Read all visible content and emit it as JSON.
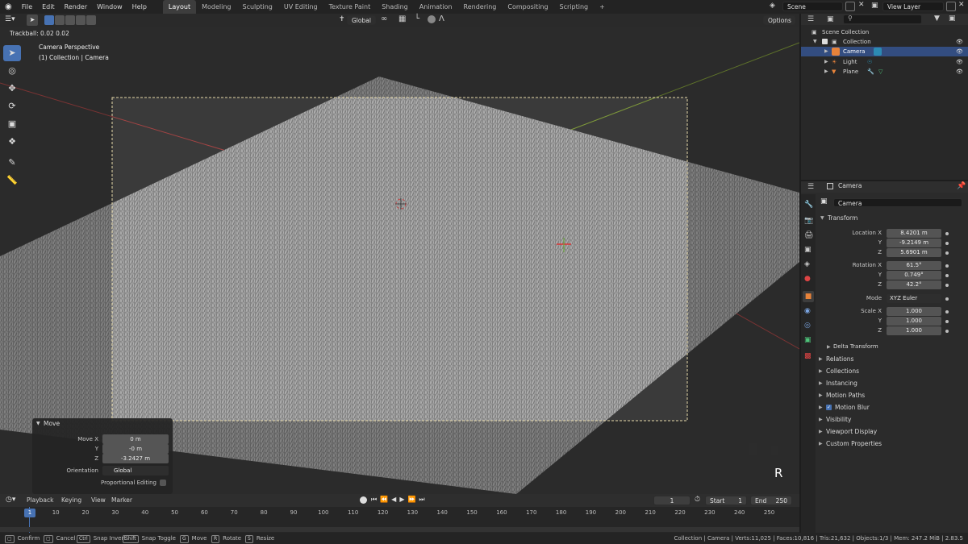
{
  "menu": {
    "items": [
      "File",
      "Edit",
      "Render",
      "Window",
      "Help"
    ],
    "workspaces": [
      "Layout",
      "Modeling",
      "Sculpting",
      "UV Editing",
      "Texture Paint",
      "Shading",
      "Animation",
      "Rendering",
      "Compositing",
      "Scripting"
    ],
    "active_workspace": "Layout",
    "add_tab": "+",
    "scene": "Scene",
    "view_layer": "View Layer"
  },
  "view_header": {
    "orientation": "Global",
    "options": "Options"
  },
  "viewport": {
    "trackball": "Trackball: 0.02 0.02",
    "view_name": "Camera Perspective",
    "view_collection": "(1) Collection | Camera",
    "key_indicator": "R"
  },
  "move_panel": {
    "title": "Move",
    "move_x_label": "Move X",
    "move_x": "0 m",
    "y_label": "Y",
    "y": "-0 m",
    "z_label": "Z",
    "z": "-3.2427 m",
    "orientation_label": "Orientation",
    "orientation": "Global",
    "proportional_label": "Proportional Editing"
  },
  "outliner": {
    "scene_collection": "Scene Collection",
    "collection": "Collection",
    "camera": "Camera",
    "light": "Light",
    "plane": "Plane"
  },
  "properties": {
    "object_name": "Camera",
    "datablock": "Camera",
    "transform_title": "Transform",
    "location_x_label": "Location X",
    "location_x": "8.4201 m",
    "location_y": "-9.2149 m",
    "location_z": "5.6901 m",
    "rotation_x_label": "Rotation X",
    "rotation_x": "61.5°",
    "rotation_y": "0.749°",
    "rotation_z": "42.2°",
    "mode_label": "Mode",
    "mode": "XYZ Euler",
    "scale_x_label": "Scale X",
    "scale_x": "1.000",
    "scale_y": "1.000",
    "scale_z": "1.000",
    "y_label": "Y",
    "z_label": "Z",
    "delta_transform": "Delta Transform",
    "panels": [
      "Relations",
      "Collections",
      "Instancing",
      "Motion Paths",
      "Motion Blur",
      "Visibility",
      "Viewport Display",
      "Custom Properties"
    ]
  },
  "timeline": {
    "playback": "Playback",
    "keying": "Keying",
    "view": "View",
    "marker": "Marker",
    "current_frame": "1",
    "start_label": "Start",
    "start": "1",
    "end_label": "End",
    "end": "250",
    "ticks": [
      "10",
      "20",
      "30",
      "40",
      "50",
      "60",
      "70",
      "80",
      "90",
      "100",
      "110",
      "120",
      "130",
      "140",
      "150",
      "160",
      "170",
      "180",
      "190",
      "200",
      "210",
      "220",
      "230",
      "240",
      "250"
    ],
    "playhead": "1"
  },
  "statusbar": {
    "confirm": "Confirm",
    "cancel": "Cancel",
    "ctrl_key": "Ctrl",
    "snap_invert": "Snap Invert",
    "shift_key": "Shift",
    "snap_toggle": "Snap Toggle",
    "g_key": "G",
    "move": "Move",
    "r_key": "R",
    "rotate": "Rotate",
    "s_key": "S",
    "resize": "Resize",
    "stats": "Collection | Camera | Verts:11,025 | Faces:10,816 | Tris:21,632 | Objects:1/3 | Mem: 247.2 MiB | 2.83.5"
  },
  "colors": {
    "accent": "#4772b3",
    "selected_row": "#334d80",
    "camera_orange": "#e8833a",
    "camera_frame": "#e6d8a8"
  }
}
